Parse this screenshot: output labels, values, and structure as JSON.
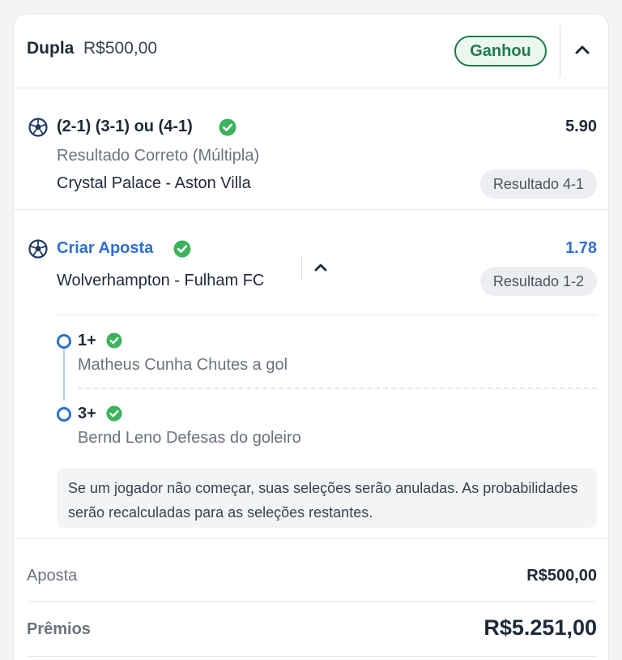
{
  "header": {
    "bet_type": "Dupla",
    "stake": "R$500,00",
    "status": "Ganhou"
  },
  "selections": [
    {
      "title": "(2-1) (3-1) ou (4-1)",
      "odds": "5.90",
      "market": "Resultado Correto (Múltipla)",
      "event": "Crystal Palace - Aston Villa",
      "result": "Resultado 4-1"
    },
    {
      "title": "Criar Aposta",
      "odds": "1.78",
      "event": "Wolverhampton - Fulham FC",
      "result": "Resultado 1-2",
      "legs": [
        {
          "value": "1+",
          "description": "Matheus Cunha Chutes a gol"
        },
        {
          "value": "3+",
          "description": "Bernd Leno Defesas do goleiro"
        }
      ],
      "notice": "Se um jogador não começar, suas seleções serão anuladas. As probabilidades serão recalculadas para as seleções restantes."
    }
  ],
  "totals": {
    "stake_label": "Aposta",
    "stake_value": "R$500,00",
    "prize_label": "Prêmios",
    "prize_value": "R$5.251,00"
  },
  "colors": {
    "won_green": "#1e7b4a",
    "check_green": "#3db35e",
    "link_blue": "#2f6fcf"
  },
  "icons": [
    "soccer-ball-icon",
    "check-circle-icon",
    "chevron-up-icon",
    "leg-dot-icon"
  ]
}
